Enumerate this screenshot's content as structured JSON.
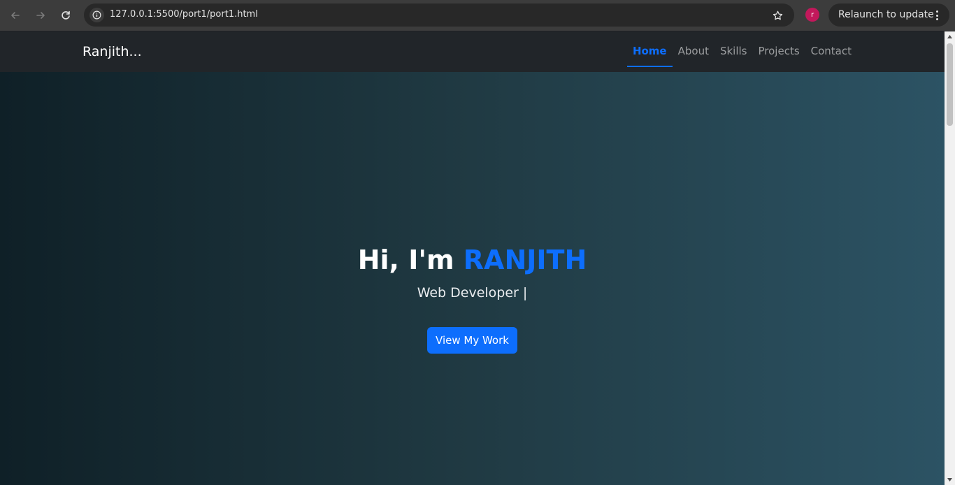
{
  "browser": {
    "url": "127.0.0.1:5500/port1/port1.html",
    "profile_initial": "r",
    "relaunch_label": "Relaunch to update",
    "icons": [
      "back-arrow-icon",
      "forward-arrow-icon",
      "reload-icon",
      "info-icon",
      "star-icon",
      "kebab-menu-icon"
    ]
  },
  "site": {
    "brand": "Ranjith...",
    "nav": [
      {
        "label": "Home",
        "active": true
      },
      {
        "label": "About",
        "active": false
      },
      {
        "label": "Skills",
        "active": false
      },
      {
        "label": "Projects",
        "active": false
      },
      {
        "label": "Contact",
        "active": false
      }
    ]
  },
  "hero": {
    "greeting": "Hi, I'm ",
    "name": "RANJITH",
    "subtitle": "Web Developer |",
    "cta_label": "View My Work"
  },
  "colors": {
    "accent": "#0d6efd",
    "navbar": "#212529",
    "gradient_start": "#0f2027",
    "gradient_end": "#2c5364"
  }
}
